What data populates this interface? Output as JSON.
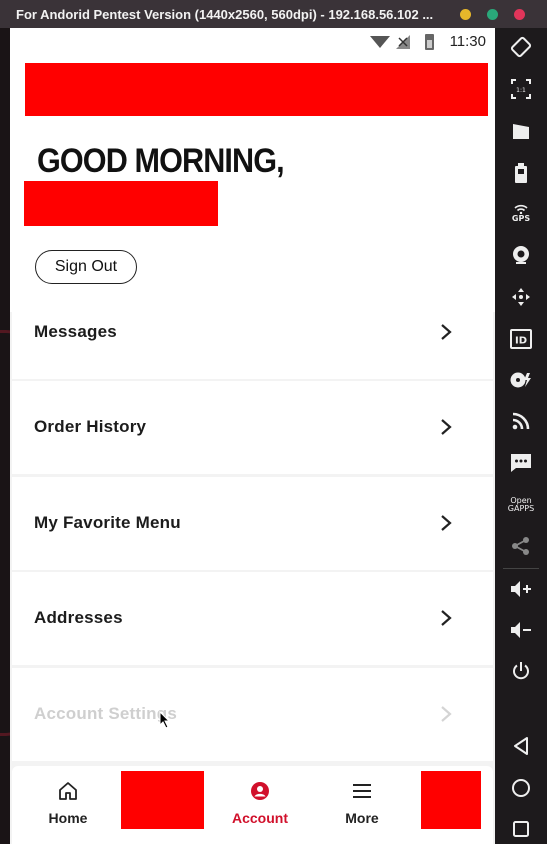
{
  "window": {
    "title": "For Andorid Pentest Version (1440x2560, 560dpi) - 192.168.56.102 ...",
    "controls": [
      {
        "name": "minimize",
        "color": "#e6b72a"
      },
      {
        "name": "maximize",
        "color": "#2aa87a"
      },
      {
        "name": "close",
        "color": "#e0355a"
      }
    ]
  },
  "status_bar": {
    "time": "11:30"
  },
  "header": {
    "greeting": "GOOD MORNING,",
    "sign_out_label": "Sign Out"
  },
  "menu": {
    "items": [
      {
        "label": "Messages"
      },
      {
        "label": "Order History"
      },
      {
        "label": "My Favorite Menu"
      },
      {
        "label": "Addresses"
      },
      {
        "label": "Account Settings"
      }
    ]
  },
  "bottom_nav": {
    "items": [
      {
        "label": "Home",
        "icon": "home-icon"
      },
      {
        "label": "Account",
        "icon": "account-icon",
        "active": true
      },
      {
        "label": "More",
        "icon": "menu-icon"
      }
    ],
    "active_color": "#d1102b"
  },
  "toolbar": {
    "gps_label": "GPS",
    "id_label": "ID",
    "opengapps_label": "Open GAPPS",
    "scale_label": "1:1"
  }
}
